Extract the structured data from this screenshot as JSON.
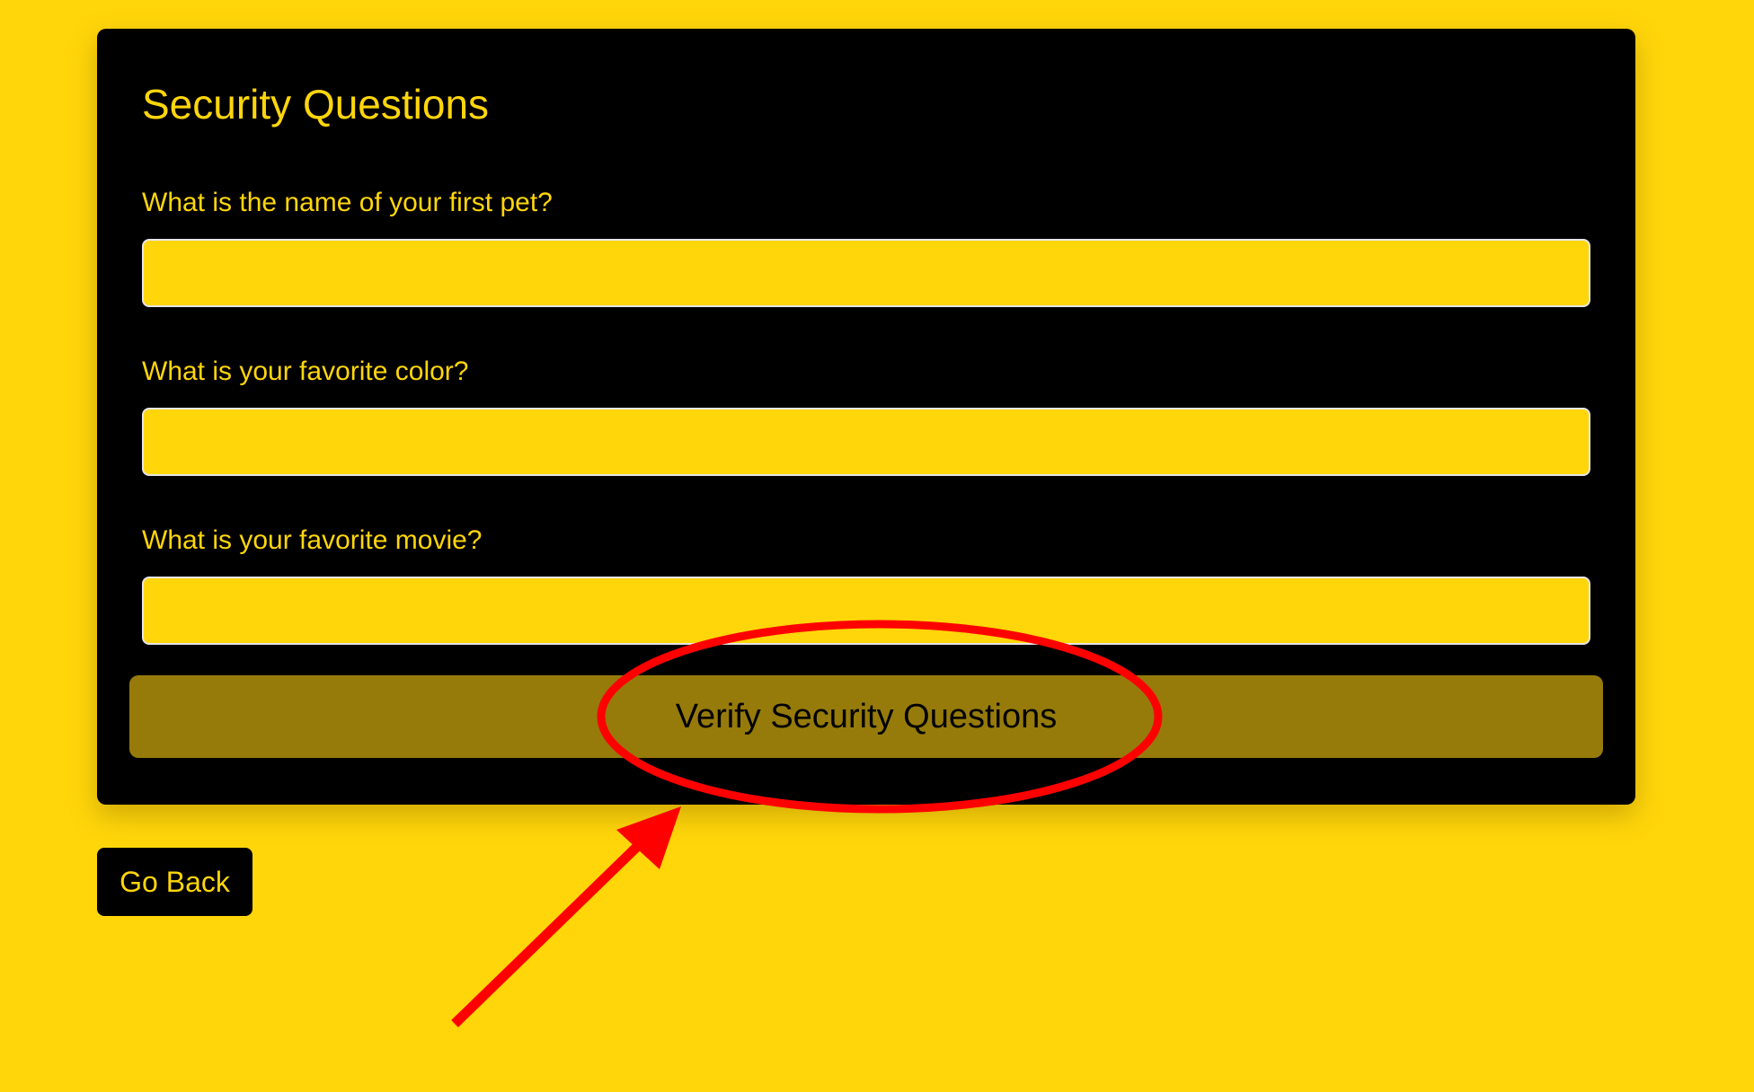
{
  "page": {
    "background_color": "#FFD60A",
    "accent_color": "#FFD60A",
    "card_color": "#000000",
    "button_color": "#967B0B",
    "annotation_color": "#FF0000"
  },
  "card": {
    "title": "Security Questions",
    "questions": [
      {
        "label": "What is the name of your first pet?",
        "value": "",
        "placeholder": ""
      },
      {
        "label": "What is your favorite color?",
        "value": "",
        "placeholder": ""
      },
      {
        "label": "What is your favorite movie?",
        "value": "",
        "placeholder": ""
      }
    ],
    "verify_label": "Verify Security Questions"
  },
  "nav": {
    "go_back_label": "Go Back"
  },
  "annotation": {
    "shapes": [
      "highlight-ellipse",
      "pointer-arrow"
    ]
  }
}
